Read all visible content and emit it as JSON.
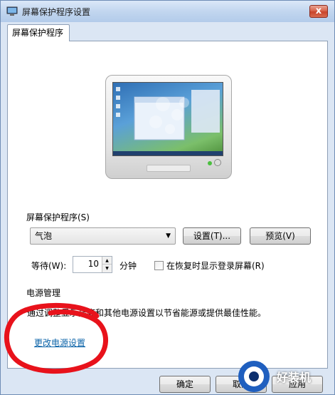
{
  "window": {
    "title": "屏幕保护程序设置",
    "close_glyph": "x"
  },
  "tab": {
    "label": "屏幕保护程序"
  },
  "screensaver": {
    "group_label": "屏幕保护程序(S)",
    "selected": "气泡",
    "settings_button": "设置(T)...",
    "preview_button": "预览(V)",
    "wait_label": "等待(W):",
    "wait_value": "10",
    "unit_label": "分钟",
    "resume_label": "在恢复时显示登录屏幕(R)",
    "resume_checked": false
  },
  "power": {
    "group_label": "电源管理",
    "description": "通过调整显示亮度和其他电源设置以节省能源或提供最佳性能。",
    "link": "更改电源设置"
  },
  "footer": {
    "ok_button": "确定",
    "cancel_button": "取消",
    "apply_button": "应用"
  },
  "watermark": {
    "text": "好装机"
  },
  "colors": {
    "annotation": "#e8121b",
    "link": "#0b63a8"
  }
}
